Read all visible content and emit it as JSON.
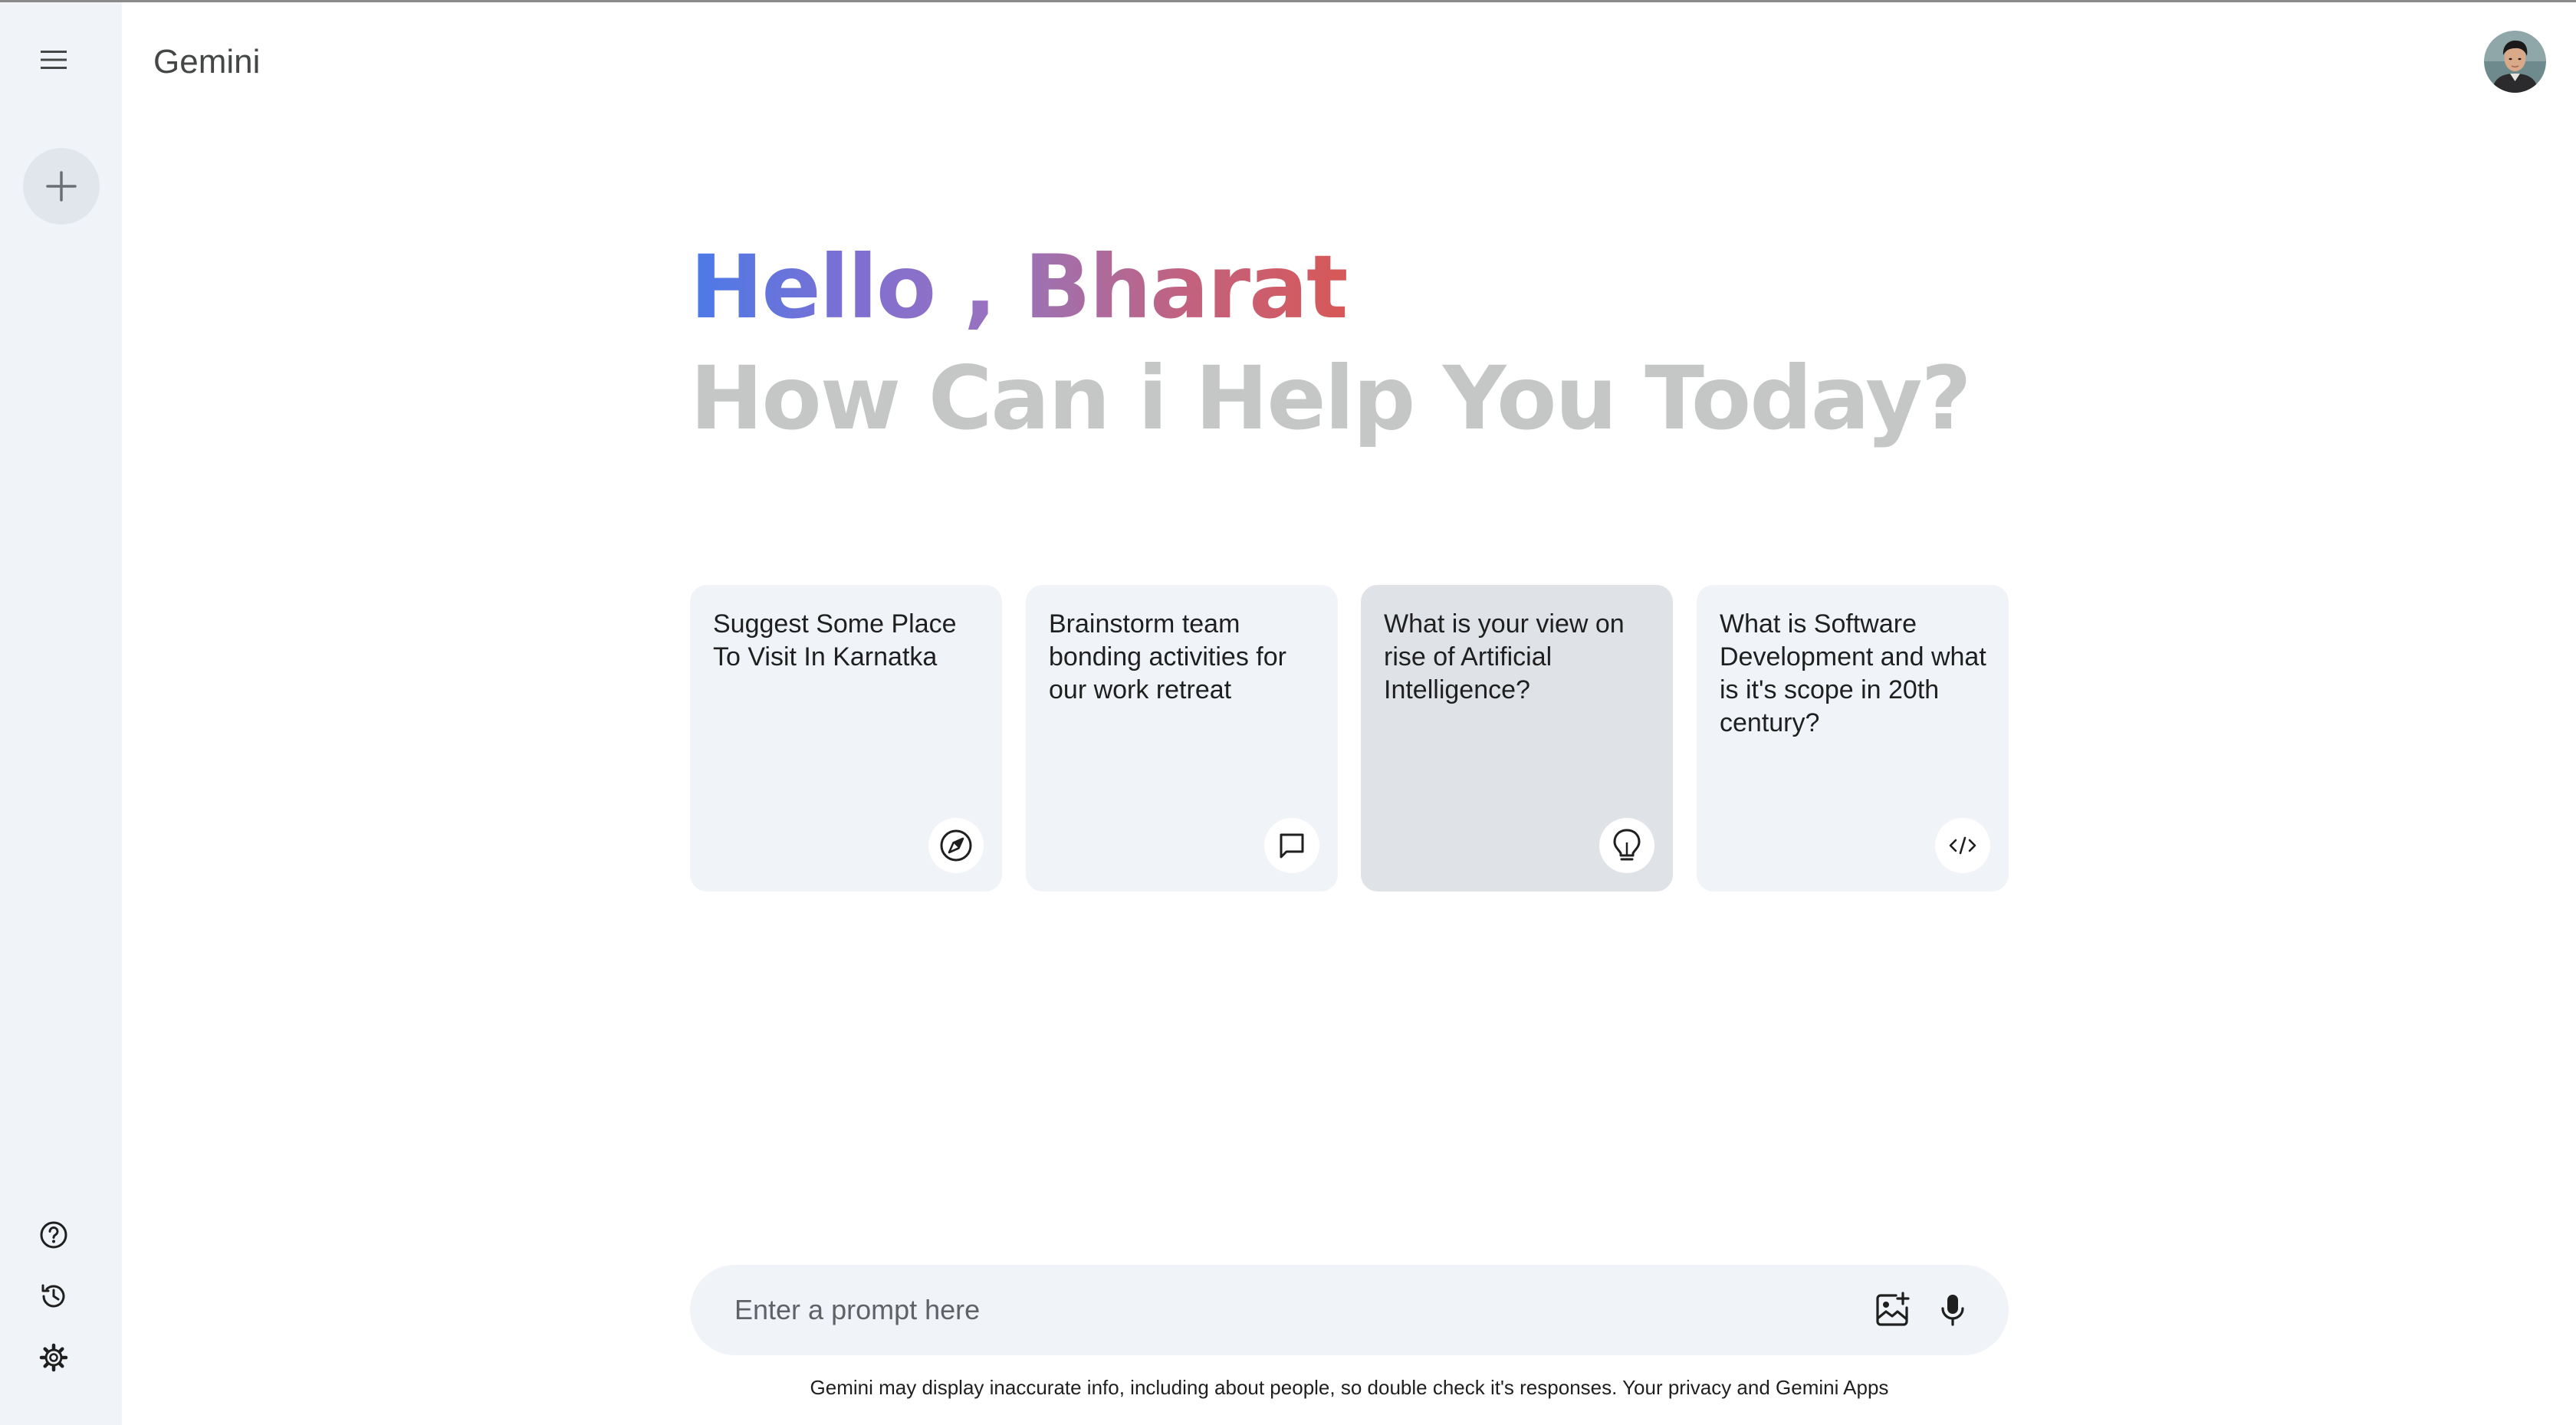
{
  "app": {
    "title": "Gemini"
  },
  "sidebar": {
    "icons": {
      "menu": "menu-icon",
      "new_chat": "plus-icon",
      "help": "help-icon",
      "activity": "history-icon",
      "settings": "gear-icon"
    }
  },
  "greeting": {
    "hello": "Hello ,",
    "name": "Bharat",
    "subtitle": "How Can i Help You Today?"
  },
  "cards": [
    {
      "text": "Suggest Some Place To Visit In Karnatka",
      "icon": "compass-icon"
    },
    {
      "text": "Brainstorm team bonding activities for our work retreat",
      "icon": "message-icon"
    },
    {
      "text": "What is your view on rise of Artificial Intelligence?",
      "icon": "bulb-icon"
    },
    {
      "text": "What is Software Development and what is it's scope in 20th century?",
      "icon": "code-icon"
    }
  ],
  "prompt": {
    "placeholder": "Enter a prompt here",
    "value": ""
  },
  "footer": {
    "disclaimer": "Gemini may display inaccurate info, including about people, so double check it's responses. Your privacy and Gemini Apps"
  },
  "colors": {
    "sidebar_bg": "#f0f4f9",
    "gradient_blue": "#4b7ae8",
    "gradient_red": "#d75857",
    "subtitle_gray": "#c4c7c5"
  }
}
